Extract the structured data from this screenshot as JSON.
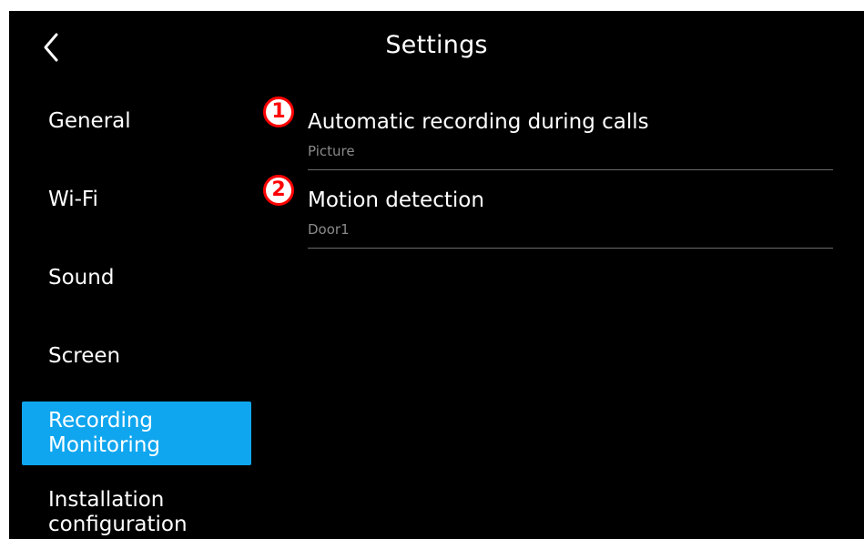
{
  "header": {
    "title": "Settings",
    "back_icon": "chevron-left-icon"
  },
  "sidebar": {
    "items": [
      {
        "label": "General"
      },
      {
        "label": "Wi-Fi"
      },
      {
        "label": "Sound"
      },
      {
        "label": "Screen"
      },
      {
        "label_line1": "Recording",
        "label_line2": "Monitoring",
        "active": true
      },
      {
        "label_line1": "Installation",
        "label_line2": "configuration"
      }
    ],
    "active_color": "#10a6ef"
  },
  "content": {
    "rows": [
      {
        "badge": "1",
        "title": "Automatic recording during calls",
        "subtitle": "Picture"
      },
      {
        "badge": "2",
        "title": "Motion detection",
        "subtitle": "Door1"
      }
    ]
  },
  "colors": {
    "background": "#000000",
    "badge": "#ff0000",
    "subtitle": "#8a8a8a"
  }
}
